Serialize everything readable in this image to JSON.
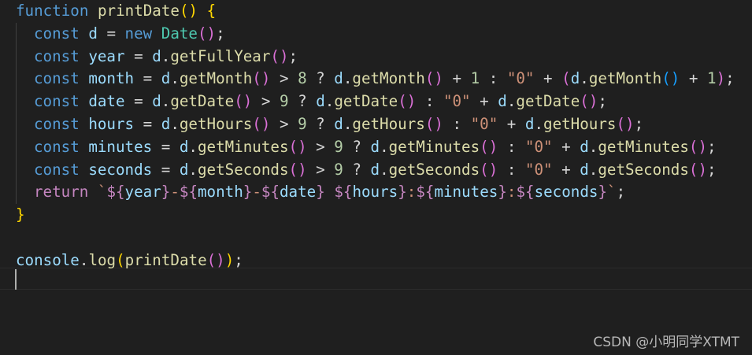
{
  "editor": {
    "lines": [
      [
        [
          "kw",
          "function"
        ],
        [
          "pun",
          " "
        ],
        [
          "fn",
          "printDate"
        ],
        [
          "b1",
          "()"
        ],
        [
          "pun",
          " "
        ],
        [
          "b1",
          "{"
        ]
      ],
      [
        [
          "kw",
          "const"
        ],
        [
          "pun",
          " "
        ],
        [
          "var",
          "d"
        ],
        [
          "pun",
          " = "
        ],
        [
          "kw",
          "new"
        ],
        [
          "pun",
          " "
        ],
        [
          "cls",
          "Date"
        ],
        [
          "b2",
          "()"
        ],
        [
          "pun",
          ";"
        ]
      ],
      [
        [
          "kw",
          "const"
        ],
        [
          "pun",
          " "
        ],
        [
          "var",
          "year"
        ],
        [
          "pun",
          " = "
        ],
        [
          "var",
          "d"
        ],
        [
          "pun",
          "."
        ],
        [
          "fn",
          "getFullYear"
        ],
        [
          "b2",
          "()"
        ],
        [
          "pun",
          ";"
        ]
      ],
      [
        [
          "kw",
          "const"
        ],
        [
          "pun",
          " "
        ],
        [
          "var",
          "month"
        ],
        [
          "pun",
          " = "
        ],
        [
          "var",
          "d"
        ],
        [
          "pun",
          "."
        ],
        [
          "fn",
          "getMonth"
        ],
        [
          "b2",
          "()"
        ],
        [
          "pun",
          " > "
        ],
        [
          "num",
          "8"
        ],
        [
          "pun",
          " ? "
        ],
        [
          "var",
          "d"
        ],
        [
          "pun",
          "."
        ],
        [
          "fn",
          "getMonth"
        ],
        [
          "b2",
          "()"
        ],
        [
          "pun",
          " + "
        ],
        [
          "num",
          "1"
        ],
        [
          "pun",
          " : "
        ],
        [
          "str",
          "\"0\""
        ],
        [
          "pun",
          " + "
        ],
        [
          "b2",
          "("
        ],
        [
          "var",
          "d"
        ],
        [
          "pun",
          "."
        ],
        [
          "fn",
          "getMonth"
        ],
        [
          "b3",
          "()"
        ],
        [
          "pun",
          " + "
        ],
        [
          "num",
          "1"
        ],
        [
          "b2",
          ")"
        ],
        [
          "pun",
          ";"
        ]
      ],
      [
        [
          "kw",
          "const"
        ],
        [
          "pun",
          " "
        ],
        [
          "var",
          "date"
        ],
        [
          "pun",
          " = "
        ],
        [
          "var",
          "d"
        ],
        [
          "pun",
          "."
        ],
        [
          "fn",
          "getDate"
        ],
        [
          "b2",
          "()"
        ],
        [
          "pun",
          " > "
        ],
        [
          "num",
          "9"
        ],
        [
          "pun",
          " ? "
        ],
        [
          "var",
          "d"
        ],
        [
          "pun",
          "."
        ],
        [
          "fn",
          "getDate"
        ],
        [
          "b2",
          "()"
        ],
        [
          "pun",
          " : "
        ],
        [
          "str",
          "\"0\""
        ],
        [
          "pun",
          " + "
        ],
        [
          "var",
          "d"
        ],
        [
          "pun",
          "."
        ],
        [
          "fn",
          "getDate"
        ],
        [
          "b2",
          "()"
        ],
        [
          "pun",
          ";"
        ]
      ],
      [
        [
          "kw",
          "const"
        ],
        [
          "pun",
          " "
        ],
        [
          "var",
          "hours"
        ],
        [
          "pun",
          " = "
        ],
        [
          "var",
          "d"
        ],
        [
          "pun",
          "."
        ],
        [
          "fn",
          "getHours"
        ],
        [
          "b2",
          "()"
        ],
        [
          "pun",
          " > "
        ],
        [
          "num",
          "9"
        ],
        [
          "pun",
          " ? "
        ],
        [
          "var",
          "d"
        ],
        [
          "pun",
          "."
        ],
        [
          "fn",
          "getHours"
        ],
        [
          "b2",
          "()"
        ],
        [
          "pun",
          " : "
        ],
        [
          "str",
          "\"0\""
        ],
        [
          "pun",
          " + "
        ],
        [
          "var",
          "d"
        ],
        [
          "pun",
          "."
        ],
        [
          "fn",
          "getHours"
        ],
        [
          "b2",
          "()"
        ],
        [
          "pun",
          ";"
        ]
      ],
      [
        [
          "kw",
          "const"
        ],
        [
          "pun",
          " "
        ],
        [
          "var",
          "minutes"
        ],
        [
          "pun",
          " = "
        ],
        [
          "var",
          "d"
        ],
        [
          "pun",
          "."
        ],
        [
          "fn",
          "getMinutes"
        ],
        [
          "b2",
          "()"
        ],
        [
          "pun",
          " > "
        ],
        [
          "num",
          "9"
        ],
        [
          "pun",
          " ? "
        ],
        [
          "var",
          "d"
        ],
        [
          "pun",
          "."
        ],
        [
          "fn",
          "getMinutes"
        ],
        [
          "b2",
          "()"
        ],
        [
          "pun",
          " : "
        ],
        [
          "str",
          "\"0\""
        ],
        [
          "pun",
          " + "
        ],
        [
          "var",
          "d"
        ],
        [
          "pun",
          "."
        ],
        [
          "fn",
          "getMinutes"
        ],
        [
          "b2",
          "()"
        ],
        [
          "pun",
          ";"
        ]
      ],
      [
        [
          "kw",
          "const"
        ],
        [
          "pun",
          " "
        ],
        [
          "var",
          "seconds"
        ],
        [
          "pun",
          " = "
        ],
        [
          "var",
          "d"
        ],
        [
          "pun",
          "."
        ],
        [
          "fn",
          "getSeconds"
        ],
        [
          "b2",
          "()"
        ],
        [
          "pun",
          " > "
        ],
        [
          "num",
          "9"
        ],
        [
          "pun",
          " ? "
        ],
        [
          "var",
          "d"
        ],
        [
          "pun",
          "."
        ],
        [
          "fn",
          "getSeconds"
        ],
        [
          "b2",
          "()"
        ],
        [
          "pun",
          " : "
        ],
        [
          "str",
          "\"0\""
        ],
        [
          "pun",
          " + "
        ],
        [
          "var",
          "d"
        ],
        [
          "pun",
          "."
        ],
        [
          "fn",
          "getSeconds"
        ],
        [
          "b2",
          "()"
        ],
        [
          "pun",
          ";"
        ]
      ],
      [
        [
          "ctl",
          "return"
        ],
        [
          "pun",
          " "
        ],
        [
          "tpl",
          "`"
        ],
        [
          "tplp",
          "${"
        ],
        [
          "var",
          "year"
        ],
        [
          "tplp",
          "}"
        ],
        [
          "tpl",
          "-"
        ],
        [
          "tplp",
          "${"
        ],
        [
          "var",
          "month"
        ],
        [
          "tplp",
          "}"
        ],
        [
          "tpl",
          "-"
        ],
        [
          "tplp",
          "${"
        ],
        [
          "var",
          "date"
        ],
        [
          "tplp",
          "}"
        ],
        [
          "tpl",
          " "
        ],
        [
          "tplp",
          "${"
        ],
        [
          "var",
          "hours"
        ],
        [
          "tplp",
          "}"
        ],
        [
          "tpl",
          ":"
        ],
        [
          "tplp",
          "${"
        ],
        [
          "var",
          "minutes"
        ],
        [
          "tplp",
          "}"
        ],
        [
          "tpl",
          ":"
        ],
        [
          "tplp",
          "${"
        ],
        [
          "var",
          "seconds"
        ],
        [
          "tplp",
          "}"
        ],
        [
          "tpl",
          "`"
        ],
        [
          "pun",
          ";"
        ]
      ],
      [
        [
          "b1",
          "}"
        ]
      ],
      [],
      [
        [
          "var",
          "console"
        ],
        [
          "pun",
          "."
        ],
        [
          "fn",
          "log"
        ],
        [
          "b1",
          "("
        ],
        [
          "fn",
          "printDate"
        ],
        [
          "b2",
          "()"
        ],
        [
          "b1",
          ")"
        ],
        [
          "pun",
          ";"
        ]
      ]
    ],
    "watermark": "CSDN @小明同学XTMT"
  }
}
